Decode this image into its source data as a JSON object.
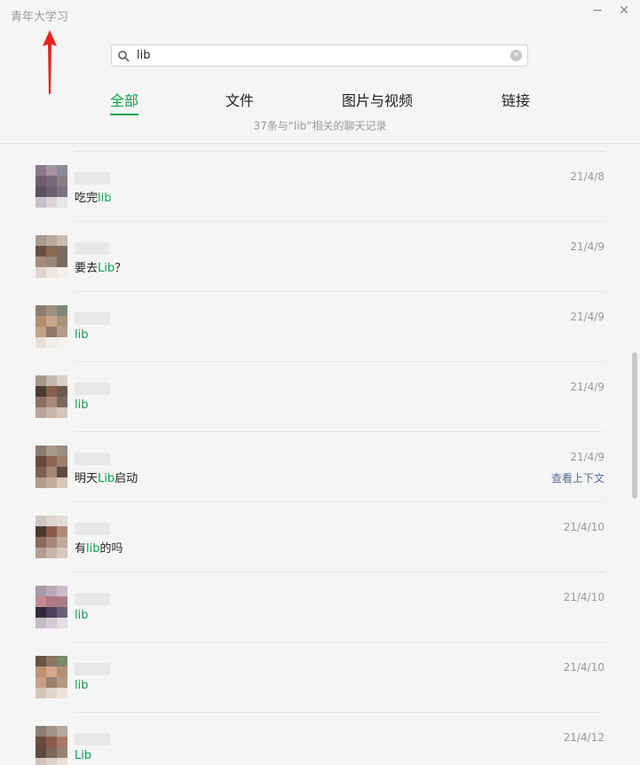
{
  "window": {
    "title": "青年大学习",
    "minimize_glyph": "−",
    "close_glyph": "✕"
  },
  "search": {
    "value": "lib",
    "icon": "search-icon",
    "clear_glyph": "×"
  },
  "tabs": [
    {
      "label": "全部",
      "active": true
    },
    {
      "label": "文件",
      "active": false
    },
    {
      "label": "图片与视频",
      "active": false
    },
    {
      "label": "链接",
      "active": false
    }
  ],
  "result_count": "37条与“lib”相关的聊天记录",
  "colors": {
    "accent": "#07a44b",
    "link": "#576b95",
    "annotation_arrow": "#e8231f"
  },
  "results": [
    {
      "pre": "吃完",
      "hl": "lib",
      "post": "",
      "date": "21/4/8",
      "context_link": ""
    },
    {
      "pre": "要去",
      "hl": "Lib",
      "post": "？",
      "date": "21/4/9",
      "context_link": ""
    },
    {
      "pre": "",
      "hl": "lib",
      "post": "",
      "date": "21/4/9",
      "context_link": ""
    },
    {
      "pre": "",
      "hl": "lib",
      "post": "",
      "date": "21/4/9",
      "context_link": ""
    },
    {
      "pre": "明天",
      "hl": "Lib",
      "post": "启动",
      "date": "21/4/9",
      "context_link": "查看上下文"
    },
    {
      "pre": "有",
      "hl": "lib",
      "post": "的吗",
      "date": "21/4/10",
      "context_link": ""
    },
    {
      "pre": "",
      "hl": "lib",
      "post": "",
      "date": "21/4/10",
      "context_link": ""
    },
    {
      "pre": "",
      "hl": "lib",
      "post": "",
      "date": "21/4/10",
      "context_link": ""
    },
    {
      "pre": "",
      "hl": "Lib",
      "post": "",
      "date": "21/4/12",
      "context_link": ""
    }
  ]
}
